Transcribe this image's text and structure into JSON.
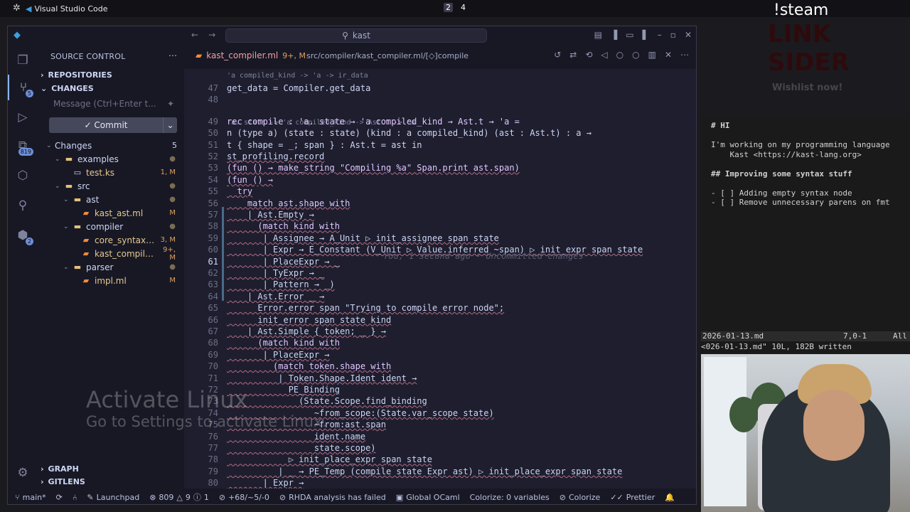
{
  "system_bar": {
    "app_name": "Visual Studio Code",
    "workspaces": [
      "2",
      "4"
    ]
  },
  "titlebar": {
    "search_text": "kast"
  },
  "activity_bar": {
    "badges": {
      "source_control": "5",
      "extensions": "819",
      "remote": "2"
    }
  },
  "sidebar": {
    "title": "SOURCE CONTROL",
    "repositories_label": "REPOSITORIES",
    "changes_label": "CHANGES",
    "message_placeholder": "Message (Ctrl+Enter t...",
    "commit_label": "Commit",
    "changes_group": {
      "label": "Changes",
      "count": "5"
    },
    "tree": [
      {
        "name": "examples",
        "kind": "folder",
        "depth": 1,
        "status": ""
      },
      {
        "name": "test.ks",
        "kind": "file",
        "depth": 2,
        "status": "1, M"
      },
      {
        "name": "src",
        "kind": "folder",
        "depth": 1,
        "status": ""
      },
      {
        "name": "ast",
        "kind": "folder",
        "depth": 2,
        "status": ""
      },
      {
        "name": "kast_ast.ml",
        "kind": "ml",
        "depth": 3,
        "status": "M"
      },
      {
        "name": "compiler",
        "kind": "folder",
        "depth": 2,
        "status": ""
      },
      {
        "name": "core_syntax.ml",
        "kind": "ml",
        "depth": 3,
        "status": "3, M"
      },
      {
        "name": "kast_compiler...",
        "kind": "ml",
        "depth": 3,
        "status": "9+, M"
      },
      {
        "name": "parser",
        "kind": "folder",
        "depth": 2,
        "status": ""
      },
      {
        "name": "impl.ml",
        "kind": "ml",
        "depth": 3,
        "status": "M"
      }
    ],
    "graph_label": "GRAPH",
    "gitlens_label": "GITLENS"
  },
  "editor": {
    "tab_name": "kast_compiler.ml",
    "tab_status": "9+, M",
    "breadcrumb": "src/compiler/kast_compiler.ml/",
    "breadcrumb_symbol": "compile",
    "hint_46": "'a compiled_kind -> 'a -> ir_data",
    "hint_48": "'a. state -> 'a compiled_kind -> Ast.t -> 'a",
    "blame_61": "You, 1 second ago • Uncommitted changes",
    "lines": [
      {
        "n": "47",
        "text": "get_data = Compiler.get_data"
      },
      {
        "n": "48",
        "text": ""
      },
      {
        "n": "49",
        "text": "rec compile : 'a. state → 'a compiled_kind → Ast.t → 'a ="
      },
      {
        "n": "50",
        "text": "n (type a) (state : state) (kind : a compiled_kind) (ast : Ast.t) : a →"
      },
      {
        "n": "51",
        "text": "t { shape = _; span } : Ast.t = ast in"
      },
      {
        "n": "52",
        "text": "st_profiling.record"
      },
      {
        "n": "53",
        "text": "(fun () → make_string \"Compiling %a\" Span.print ast.span)"
      },
      {
        "n": "54",
        "text": "(fun () →"
      },
      {
        "n": "55",
        "text": "  try"
      },
      {
        "n": "56",
        "text": "    match ast.shape with"
      },
      {
        "n": "57",
        "text": "    | Ast.Empty →"
      },
      {
        "n": "58",
        "text": "      (match kind with"
      },
      {
        "n": "59",
        "text": "       | Assignee → A_Unit ▷ init_assignee span state"
      },
      {
        "n": "60",
        "text": "       | Expr → E_Constant (V_Unit ▷ Value.inferred ~span) ▷ init_expr span state"
      },
      {
        "n": "61",
        "text": "       | PlaceExpr → _"
      },
      {
        "n": "62",
        "text": "       | TyExpr → _"
      },
      {
        "n": "63",
        "text": "       | Pattern → _)"
      },
      {
        "n": "64",
        "text": "    | Ast.Error _ →"
      },
      {
        "n": "65",
        "text": "      Error.error span \"Trying to compile error node\";"
      },
      {
        "n": "66",
        "text": "      init_error span state kind"
      },
      {
        "n": "67",
        "text": "    | Ast.Simple { token; _ } →"
      },
      {
        "n": "68",
        "text": "      (match kind with"
      },
      {
        "n": "69",
        "text": "       | PlaceExpr →"
      },
      {
        "n": "70",
        "text": "         (match token.shape with"
      },
      {
        "n": "71",
        "text": "          | Token.Shape.Ident ident →"
      },
      {
        "n": "72",
        "text": "            PE_Binding"
      },
      {
        "n": "73",
        "text": "              (State.Scope.find_binding"
      },
      {
        "n": "74",
        "text": "                 ~from_scope:(State.var_scope state)"
      },
      {
        "n": "75",
        "text": "                 ~from:ast.span"
      },
      {
        "n": "76",
        "text": "                 ident.name"
      },
      {
        "n": "77",
        "text": "                 state.scope)"
      },
      {
        "n": "78",
        "text": "            ▷ init_place_expr span state"
      },
      {
        "n": "79",
        "text": "          | _ → PE_Temp (compile state Expr ast) ▷ init_place_expr span state"
      },
      {
        "n": "80",
        "text": "       | Expr →"
      }
    ]
  },
  "watermark": {
    "line1": "Activate Linux",
    "line2": "Go to Settings to activate Linux."
  },
  "statusbar": {
    "branch": "main*",
    "launchpad": "Launchpad",
    "problems": "809",
    "warnings": "9",
    "info": "1",
    "diff": "+68/~5/-0",
    "rhda": "RHDA analysis has failed",
    "ocaml": "Global OCaml",
    "colorize_vars": "Colorize: 0 variables",
    "colorize": "Colorize",
    "prettier": "Prettier"
  },
  "stream": {
    "command": "!steam",
    "art_line1": "LINK",
    "art_line2": "SIDER",
    "wishlist": "Wishlist now!"
  },
  "terminal": {
    "lines": [
      "# HI",
      "",
      "I'm working on my programming language",
      "    Kast <https://kast-lang.org>",
      "",
      "## Improving some syntax stuff",
      "",
      "- [ ] Adding empty syntax node",
      "- [ ] Remove unnecessary parens on fmt"
    ],
    "status_file": "2026-01-13.md",
    "status_pos": "7,0-1",
    "status_all": "All",
    "message": "<026-01-13.md\" 10L, 182B written"
  },
  "colors": {
    "accent": "#89b4fa",
    "keyword": "#cba6f7",
    "function": "#f9e2af",
    "string": "#a6e3a1",
    "error": "#f38ba8"
  }
}
